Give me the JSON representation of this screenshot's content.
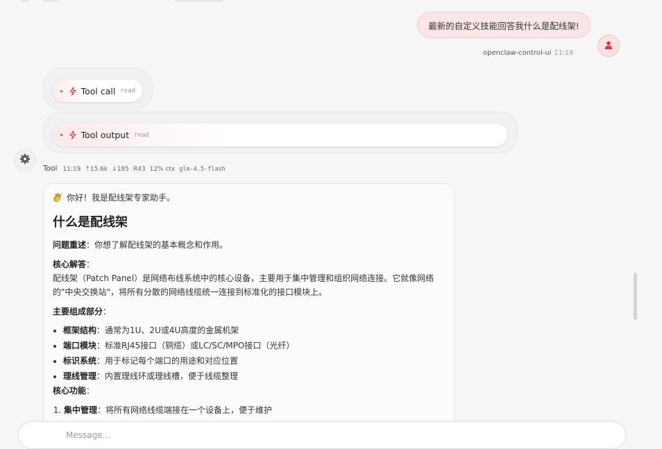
{
  "user_message": {
    "text": "最新的自定义技能回答我什么是配线架!",
    "sender": "openclaw-control-ui",
    "time": "11:19"
  },
  "tool_call": {
    "label": "Tool call",
    "tag": "read"
  },
  "tool_output": {
    "label": "Tool output",
    "tag": "read"
  },
  "assistant": {
    "meta": {
      "name": "Tool",
      "time": "11:19",
      "tokens_in": "↑15.6k",
      "tokens_out": "↓185",
      "cache": "R43",
      "ctx": "12% ctx",
      "model": "glm-4.5-flash"
    },
    "greeting": "你好！我是配线架专家助手。",
    "heading": "什么是配线架",
    "restate_label": "问题重述",
    "restate_text": "：你想了解配线架的基本概念和作用。",
    "core_label": "核心解答",
    "core_colon": "：",
    "core_text": "配线架（Patch Panel）是网络布线系统中的核心设备，主要用于集中管理和组织网络连接。它就像网络的\"中央交换站\"，将所有分散的网络线缆统一连接到标准化的接口模块上。",
    "parts_label": "主要组成部分",
    "parts_colon": "：",
    "parts": [
      {
        "label": "框架结构",
        "text": "：通常为1U、2U或4U高度的金属机架"
      },
      {
        "label": "端口模块",
        "text": "：标准RJ45接口（铜缆）或LC/SC/MPO接口（光纤）"
      },
      {
        "label": "标识系统",
        "text": "：用于标记每个端口的用途和对应位置"
      },
      {
        "label": "理线管理",
        "text": "：内置理线环或理线槽，便于线缆整理"
      }
    ],
    "funcs_label": "核心功能",
    "funcs_colon": "：",
    "funcs": [
      {
        "label": "集中管理",
        "text": "：将所有网络线缆端接在一个设备上，便于维护"
      }
    ]
  },
  "composer": {
    "placeholder": "Message..."
  },
  "colors": {
    "accent": "#d9343f",
    "user_bubble_bg": "#fbe6e7"
  },
  "icons": {
    "user_avatar": "user-icon",
    "tool": "bolt-icon",
    "assistant_avatar": "gear-icon",
    "greeting": "waving-hand-icon"
  }
}
